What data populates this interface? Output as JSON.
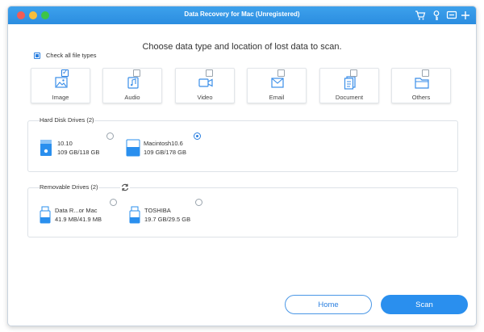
{
  "window": {
    "title": "Data Recovery for Mac (Unregistered)"
  },
  "titlebar_icons": [
    "cart-icon",
    "key-icon",
    "chat-icon",
    "plus-icon"
  ],
  "heading": "Choose data type and location of lost data to scan.",
  "check_all_label": "Check all file types",
  "file_types": [
    {
      "label": "Image",
      "icon": "image-icon",
      "checked": true
    },
    {
      "label": "Audio",
      "icon": "audio-icon",
      "checked": false
    },
    {
      "label": "Video",
      "icon": "video-icon",
      "checked": false
    },
    {
      "label": "Email",
      "icon": "email-icon",
      "checked": false
    },
    {
      "label": "Document",
      "icon": "document-icon",
      "checked": false
    },
    {
      "label": "Others",
      "icon": "folder-icon",
      "checked": false
    }
  ],
  "hard_disk": {
    "title": "Hard Disk Drives (2)",
    "drives": [
      {
        "name": "10.10",
        "size": "109 GB/118 GB",
        "selected": false
      },
      {
        "name": "Macintosh10.6",
        "size": "109 GB/178 GB",
        "selected": true
      }
    ]
  },
  "removable": {
    "title": "Removable Drives (2)",
    "drives": [
      {
        "name": "Data R...or Mac",
        "size": "41.9 MB/41.9 MB",
        "selected": false
      },
      {
        "name": "TOSHIBA",
        "size": "19.7 GB/29.5 GB",
        "selected": false
      }
    ]
  },
  "buttons": {
    "home": "Home",
    "scan": "Scan"
  },
  "colors": {
    "accent": "#2a8fee",
    "titlebar": "#2b8de0"
  }
}
